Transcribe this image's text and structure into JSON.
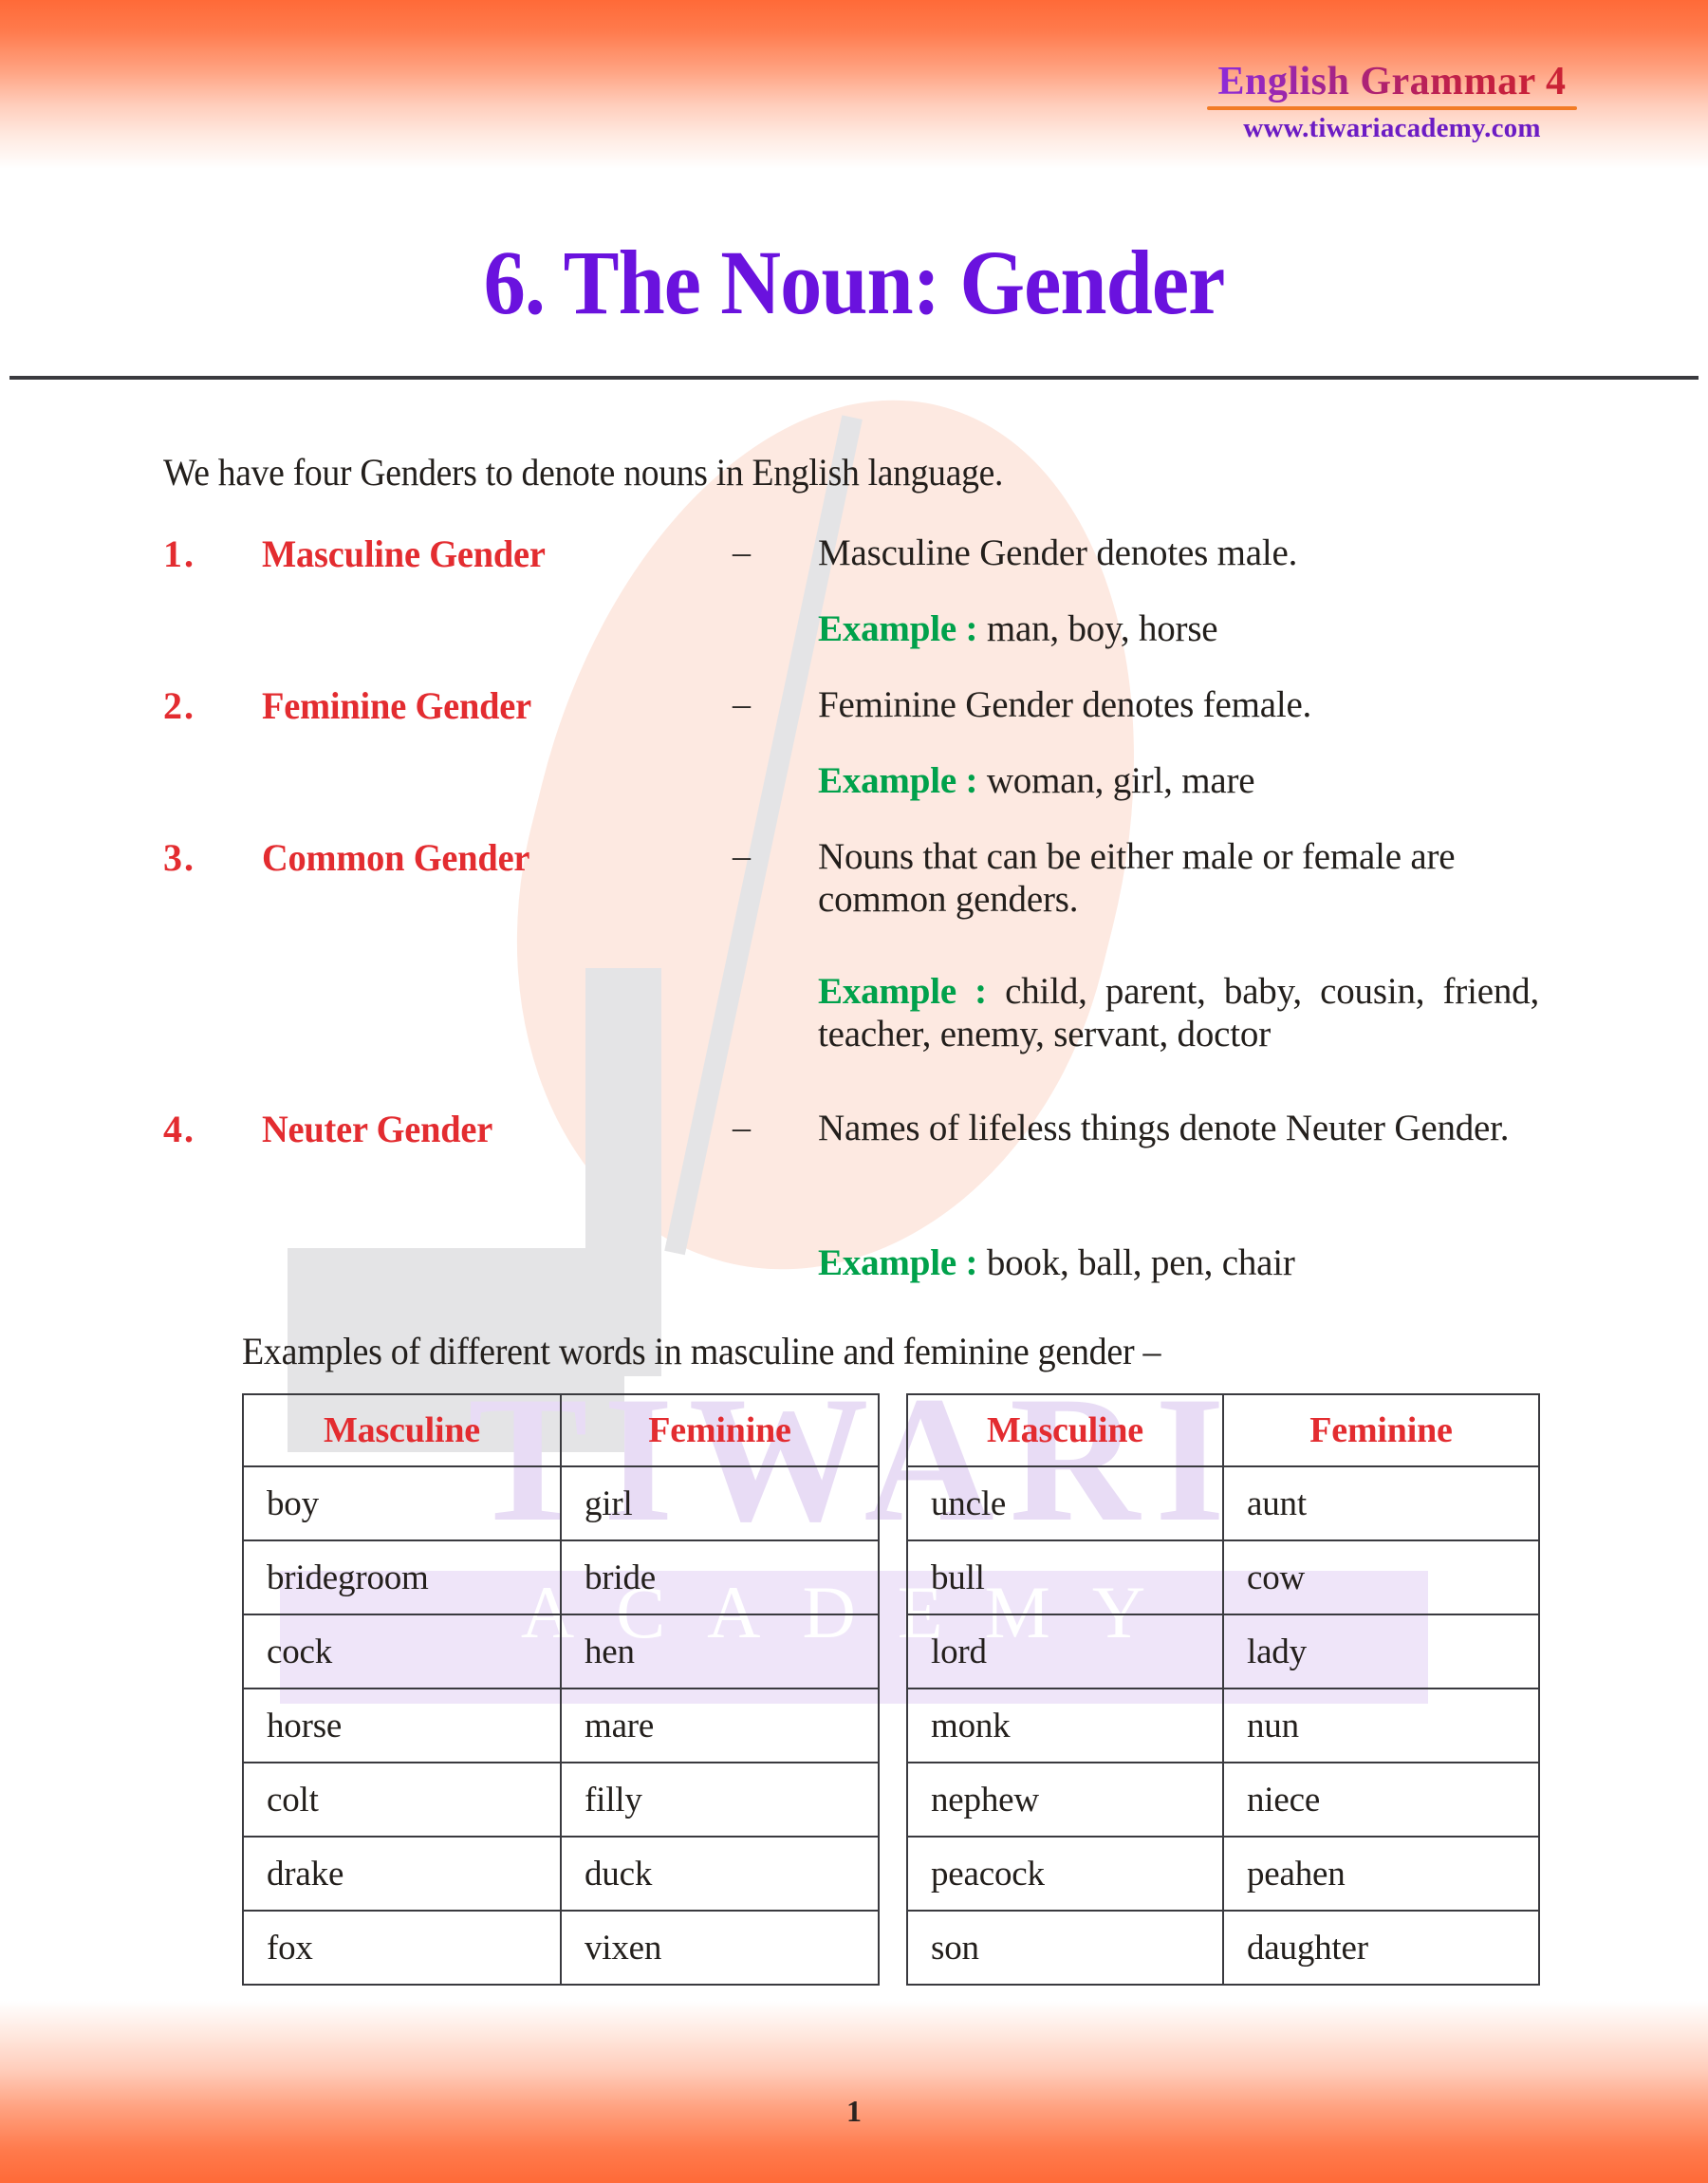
{
  "header": {
    "brand_title": "English Grammar 4",
    "brand_url": "www.tiwariacademy.com"
  },
  "page_title": "6. The Noun: Gender",
  "intro": "We have four Genders to denote nouns in English language.",
  "genders": [
    {
      "number": "1.",
      "term": "Masculine Gender",
      "dash": "–",
      "definition": "Masculine Gender denotes male.",
      "example_label": "Example :",
      "example_text": " man, boy, horse"
    },
    {
      "number": "2.",
      "term": "Feminine Gender",
      "dash": "–",
      "definition": "Feminine Gender denotes female.",
      "example_label": "Example :",
      "example_text": " woman, girl, mare"
    },
    {
      "number": "3.",
      "term": "Common Gender",
      "dash": "–",
      "definition": "Nouns that can be either male or female are common genders.",
      "example_label": "Example :",
      "example_text": " child, parent, baby, cousin, friend, teacher, enemy, servant, doctor"
    },
    {
      "number": "4.",
      "term": "Neuter Gender",
      "dash": "–",
      "definition": "Names of lifeless things denote Neuter Gender.",
      "example_label": "Example :",
      "example_text": " book, ball, pen, chair"
    }
  ],
  "tables_intro": "Examples of different words in masculine and feminine gender –",
  "tables": [
    {
      "headers": [
        "Masculine",
        "Feminine"
      ],
      "rows": [
        [
          "boy",
          "girl"
        ],
        [
          "bridegroom",
          "bride"
        ],
        [
          "cock",
          "hen"
        ],
        [
          "horse",
          "mare"
        ],
        [
          "colt",
          "filly"
        ],
        [
          "drake",
          "duck"
        ],
        [
          "fox",
          "vixen"
        ]
      ]
    },
    {
      "headers": [
        "Masculine",
        "Feminine"
      ],
      "rows": [
        [
          "uncle",
          "aunt"
        ],
        [
          "bull",
          "cow"
        ],
        [
          "lord",
          "lady"
        ],
        [
          "monk",
          "nun"
        ],
        [
          "nephew",
          "niece"
        ],
        [
          "peacock",
          "peahen"
        ],
        [
          "son",
          "daughter"
        ]
      ]
    }
  ],
  "watermark": {
    "brand": "TIWARI",
    "sub": "ACADEMY"
  },
  "footer": {
    "page_number": "1"
  },
  "colors": {
    "accent_orange": "#FF6A38",
    "title_purple": "#6A12DE",
    "term_red": "#E32C30",
    "example_green": "#00A14B",
    "url_purple": "#6C1CC4",
    "rule_gray": "#3A3A3F"
  }
}
